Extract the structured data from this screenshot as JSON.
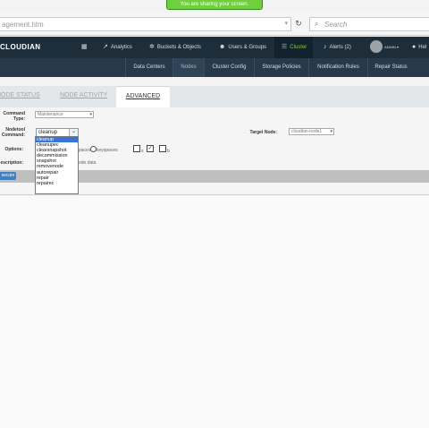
{
  "share_banner": "You are sharing your screen.",
  "browser": {
    "url": "agement.htm",
    "search_placeholder": "Search"
  },
  "topnav": {
    "logo": "CLOUDIAN",
    "items": [
      {
        "label": "Analytics",
        "icon": "chart-icon"
      },
      {
        "label": "Buckets & Objects",
        "icon": "gear-icon"
      },
      {
        "label": "Users & Groups",
        "icon": "users-icon"
      },
      {
        "label": "Cluster",
        "icon": "list-icon"
      },
      {
        "label": "Alerts (2)",
        "icon": "bell-icon"
      },
      {
        "label": "Hel",
        "icon": "help-icon"
      }
    ],
    "user": "ADMIN"
  },
  "subnav": [
    "Data Centers",
    "Nodes",
    "Cluster Config",
    "Storage Policies",
    "Notification Rules",
    "Repair Status"
  ],
  "tabs": [
    "NODE STATUS",
    "NODE ACTIVITY",
    "ADVANCED"
  ],
  "form": {
    "command_type_label": "Command Type:",
    "command_type_value": "Maintenance",
    "nodetool_label": "Nodetool Command:",
    "nodetool_value": "cleanup",
    "target_node_label": "Target Node:",
    "target_node_value": "cloudian-node1",
    "options_label": "Options:",
    "description_label": "escription:",
    "opt_text_1": "paces",
    "opt_text_2": "keyspaces",
    "opt_text_3": "s",
    "opt_text_4": "b",
    "desc_text": "ode data",
    "execute_label": "xecute"
  },
  "dropdown_options": [
    "cleanup",
    "cleanupec",
    "clearsnapshot",
    "decommission",
    "snapshot",
    "removenode",
    "autorepair",
    "repair",
    "repairec"
  ]
}
